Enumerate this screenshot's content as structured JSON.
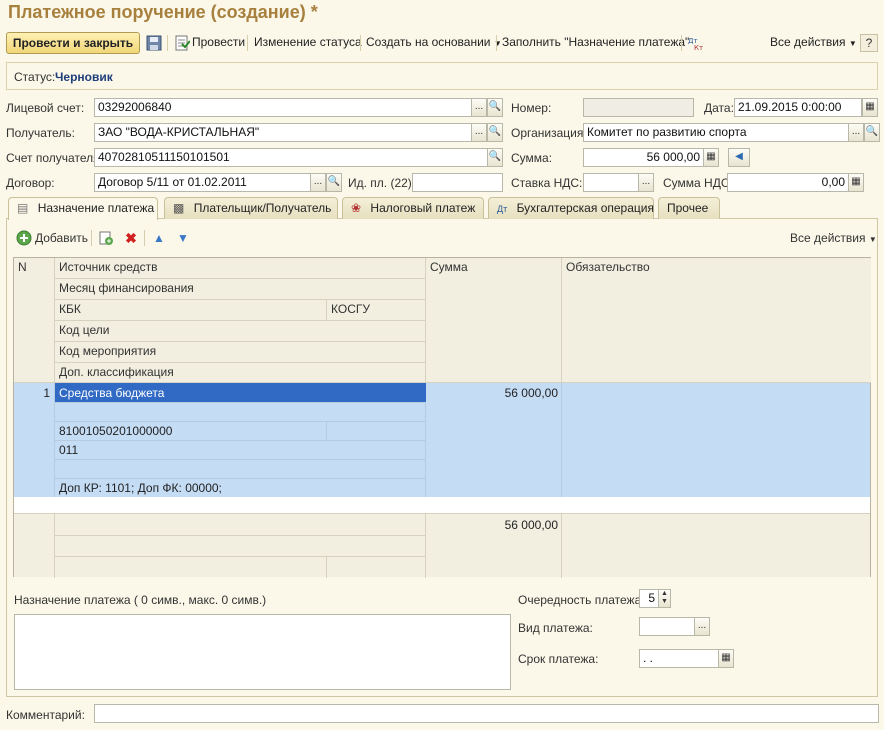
{
  "window": {
    "title": "Платежное поручение (создание) *"
  },
  "toolbar": {
    "post_close": "Провести и закрыть",
    "post": "Провести",
    "change_status": "Изменение статуса",
    "create_based": "Создать на основании",
    "fill_purpose": "Заполнить \"Назначение платежа\"",
    "all_actions": "Все действия"
  },
  "status": {
    "label": "Статус:",
    "value": "Черновик"
  },
  "form": {
    "account_label": "Лицевой счет:",
    "account_value": "03292006840",
    "number_label": "Номер:",
    "number_value": "",
    "date_label": "Дата:",
    "date_value": "21.09.2015  0:00:00",
    "recipient_label": "Получатель:",
    "recipient_value": "ЗАО \"ВОДА-КРИСТАЛЬНАЯ\"",
    "org_label": "Организация:",
    "org_value": "Комитет по развитию спорта",
    "recipient_account_label": "Счет получателя:",
    "recipient_account_value": "40702810511150101501",
    "sum_label": "Сумма:",
    "sum_value": "56 000,00",
    "contract_label": "Договор:",
    "contract_value": "Договор 5/11 от 01.02.2011",
    "idpl_label": "Ид. пл. (22):",
    "idpl_value": "",
    "vat_rate_label": "Ставка НДС:",
    "vat_rate_value": "",
    "vat_sum_label": "Сумма НДС:",
    "vat_sum_value": "0,00"
  },
  "tabs": [
    {
      "label": "Назначение платежа"
    },
    {
      "label": "Плательщик/Получатель"
    },
    {
      "label": "Налоговый платеж"
    },
    {
      "label": "Бухгалтерская операция"
    },
    {
      "label": "Прочее"
    }
  ],
  "grid_toolbar": {
    "add": "Добавить",
    "all_actions": "Все действия"
  },
  "grid": {
    "headers": {
      "n": "N",
      "source": "Источник средств",
      "month": "Месяц финансирования",
      "kbk": "КБК",
      "kosgu": "КОСГУ",
      "goal": "Код цели",
      "event": "Код мероприятия",
      "add_class": "Доп. классификация",
      "sum": "Сумма",
      "obligation": "Обязательство"
    },
    "rows": [
      {
        "n": "1",
        "source": "Средства бюджета",
        "month": "",
        "kbk": "81001050201000000",
        "kosgu": "",
        "goal": "011",
        "event": "",
        "add_class": "Доп КР: 1101; Доп ФК: 00000;",
        "sum": "56 000,00",
        "obligation": ""
      }
    ],
    "footer_sum": "56 000,00"
  },
  "bottom": {
    "purpose_label": "Назначение платежа ( 0 симв., макс. 0 симв.)",
    "purpose_value": "",
    "priority_label": "Очередность платежа:",
    "priority_value": "5",
    "payment_type_label": "Вид платежа:",
    "payment_type_value": "",
    "due_label": "Срок платежа:",
    "due_value": " .  ."
  },
  "comment": {
    "label": "Комментарий:",
    "value": ""
  }
}
